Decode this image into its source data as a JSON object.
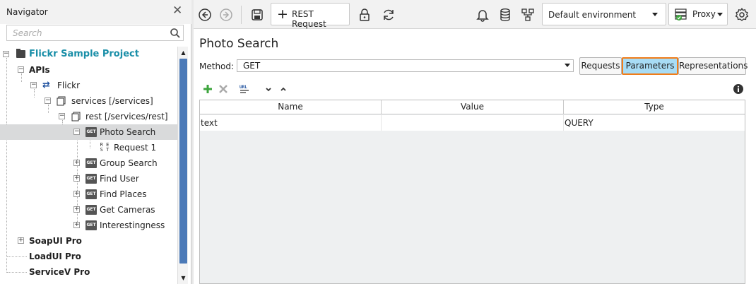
{
  "navigator": {
    "title": "Navigator",
    "search_placeholder": "Search",
    "tree": [
      {
        "label": "Flickr Sample Project",
        "type": "project"
      },
      {
        "label": "APIs",
        "type": "group"
      },
      {
        "label": "Flickr",
        "type": "api"
      },
      {
        "label": "services [/services]",
        "type": "resource"
      },
      {
        "label": "rest [/services/rest]",
        "type": "resource"
      },
      {
        "label": "Photo Search",
        "type": "method",
        "badge": "GET",
        "selected": true
      },
      {
        "label": "Request 1",
        "type": "request"
      },
      {
        "label": "Group Search",
        "type": "method",
        "badge": "GET"
      },
      {
        "label": "Find User",
        "type": "method",
        "badge": "GET"
      },
      {
        "label": "Find Places",
        "type": "method",
        "badge": "GET"
      },
      {
        "label": "Get Cameras",
        "type": "method",
        "badge": "GET"
      },
      {
        "label": "Interestingness",
        "type": "method",
        "badge": "GET"
      },
      {
        "label": "SoapUI Pro",
        "type": "group"
      },
      {
        "label": "LoadUI Pro",
        "type": "group"
      },
      {
        "label": "ServiceV Pro",
        "type": "group"
      }
    ]
  },
  "toolbar": {
    "rest_request_label": "REST Request",
    "environment": "Default environment",
    "proxy_label": "Proxy"
  },
  "editor": {
    "title": "Photo Search",
    "method_label": "Method:",
    "method_value": "GET",
    "tabs": [
      {
        "label": "Requests",
        "active": false
      },
      {
        "label": "Parameters",
        "active": true
      },
      {
        "label": "Representations",
        "active": false
      }
    ],
    "grid": {
      "columns": [
        "Name",
        "Value",
        "Type"
      ],
      "rows": [
        {
          "name": "text",
          "value": "",
          "type": "QUERY"
        }
      ]
    }
  },
  "colors": {
    "project_text": "#1a8fa8",
    "active_tab_bg": "#a8dcf5",
    "active_tab_border": "#f07d1a",
    "scroll_thumb": "#4c7ab8",
    "add_icon": "#3da53d"
  }
}
